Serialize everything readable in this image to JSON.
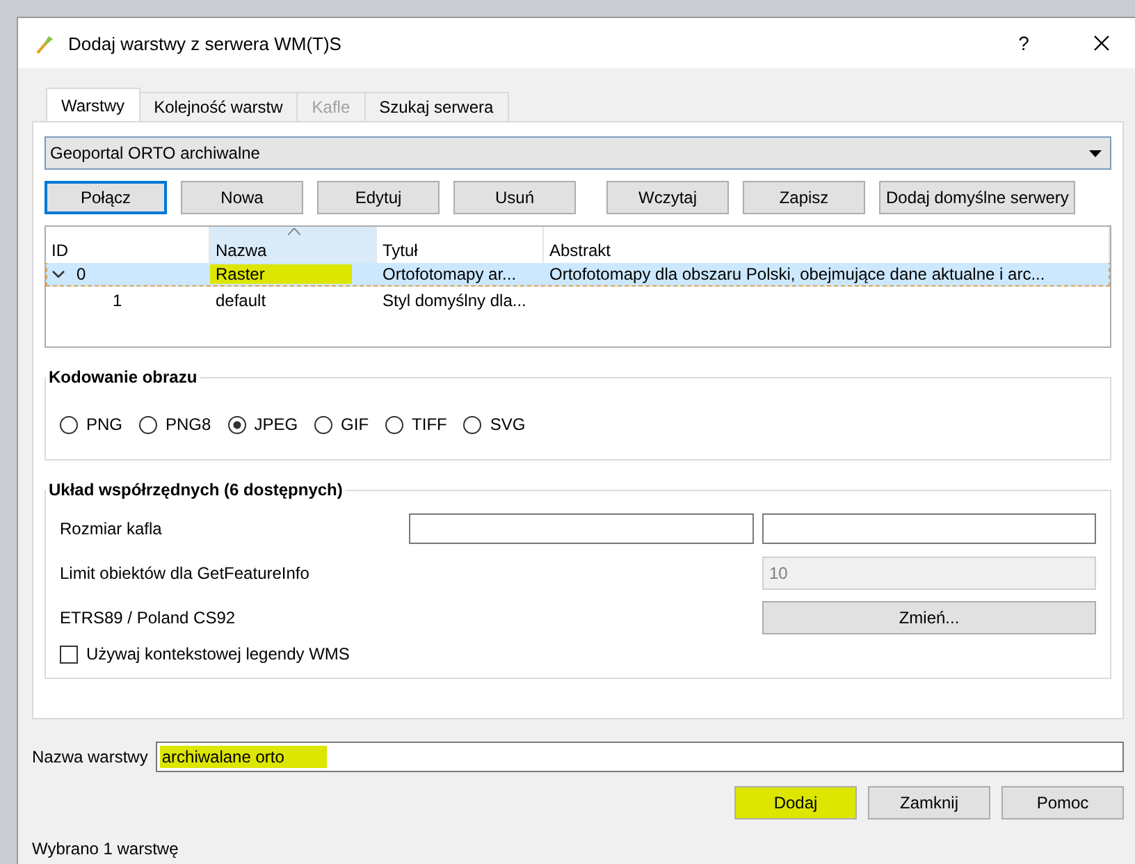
{
  "window": {
    "title": "Dodaj warstwy z serwera WM(T)S",
    "help": "?"
  },
  "tabs": [
    {
      "label": "Warstwy",
      "selected": true,
      "disabled": false
    },
    {
      "label": "Kolejność warstw",
      "selected": false,
      "disabled": false
    },
    {
      "label": "Kafle",
      "selected": false,
      "disabled": true
    },
    {
      "label": "Szukaj serwera",
      "selected": false,
      "disabled": false
    }
  ],
  "server_select": {
    "value": "Geoportal ORTO archiwalne"
  },
  "server_buttons": [
    {
      "label": "Połącz",
      "focused": true
    },
    {
      "label": "Nowa",
      "focused": false
    },
    {
      "label": "Edytuj",
      "focused": false
    },
    {
      "label": "Usuń",
      "focused": false
    },
    {
      "label": "Wczytaj",
      "focused": false
    },
    {
      "label": "Zapisz",
      "focused": false
    },
    {
      "label": "Dodaj domyślne serwery",
      "focused": false
    }
  ],
  "table": {
    "columns": [
      {
        "label": "ID",
        "sorted": false
      },
      {
        "label": "Nazwa",
        "sorted": true
      },
      {
        "label": "Tytuł",
        "sorted": false
      },
      {
        "label": "Abstrakt",
        "sorted": false
      }
    ],
    "rows": [
      {
        "id": "0",
        "name": "Raster",
        "title": "Ortofotomapy ar...",
        "abstract": "Ortofotomapy dla obszaru Polski, obejmujące dane aktualne i arc...",
        "selected": true,
        "expanded": true,
        "highlighted": true,
        "children": [
          {
            "id": "1",
            "name": "default",
            "title": "Styl domyślny dla...",
            "selected": false,
            "highlighted": false
          }
        ]
      }
    ]
  },
  "image_encoding": {
    "title": "Kodowanie obrazu",
    "options": [
      {
        "label": "PNG",
        "selected": false
      },
      {
        "label": "PNG8",
        "selected": false
      },
      {
        "label": "JPEG",
        "selected": true
      },
      {
        "label": "GIF",
        "selected": false
      },
      {
        "label": "TIFF",
        "selected": false
      },
      {
        "label": "SVG",
        "selected": false
      }
    ]
  },
  "crs": {
    "title": "Układ współrzędnych (6 dostępnych)",
    "tile_size_label": "Rozmiar kafla",
    "feature_limit_label": "Limit obiektów dla GetFeatureInfo",
    "feature_limit": "10",
    "crs_name": "ETRS89 / Poland CS92",
    "change_button": "Zmień...",
    "legend_checkbox": {
      "label": "Używaj kontekstowej legendy WMS",
      "checked": false
    }
  },
  "layer_name": {
    "label": "Nazwa warstwy",
    "value": "archiwalane orto",
    "highlighted": true
  },
  "buttons": [
    {
      "label": "Dodaj",
      "highlighted": true
    },
    {
      "label": "Zamknij",
      "highlighted": false
    },
    {
      "label": "Pomoc",
      "highlighted": false
    }
  ],
  "status": "Wybrano 1 warstwę"
}
